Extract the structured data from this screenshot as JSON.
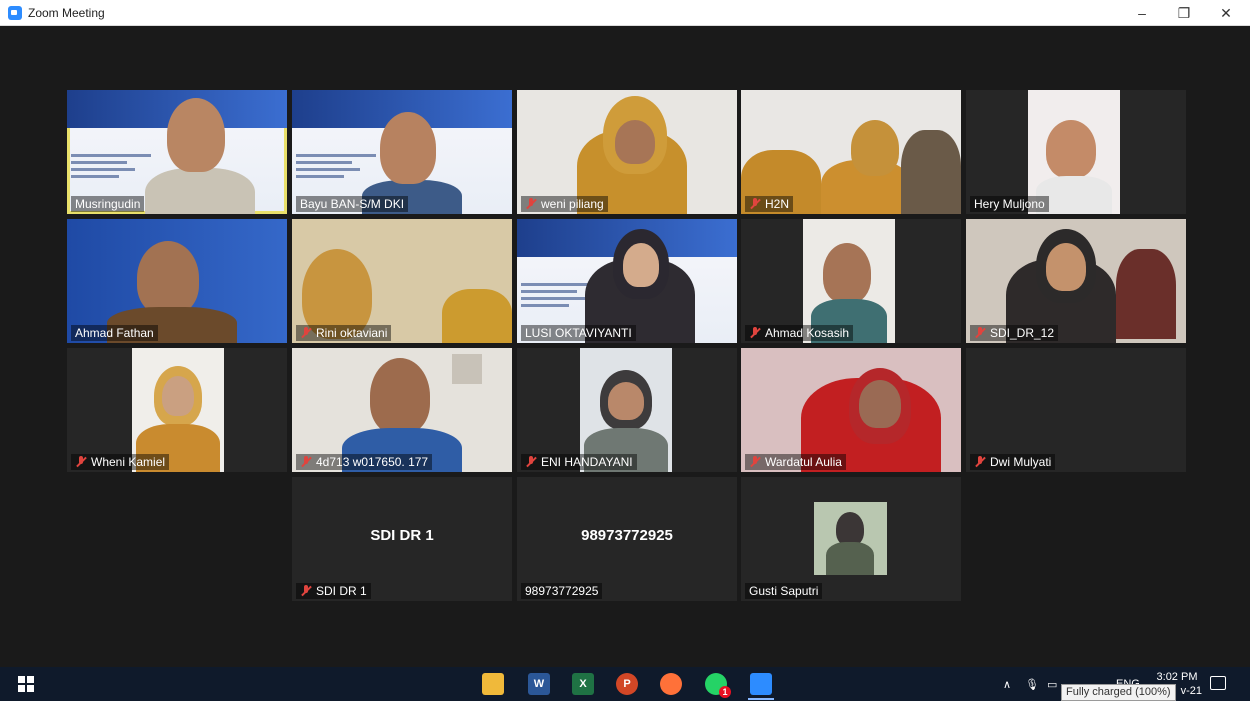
{
  "window": {
    "title": "Zoom Meeting"
  },
  "window_controls": {
    "minimize": "–",
    "restore": "❐",
    "close": "✕"
  },
  "participants": [
    {
      "name": "Musringudin",
      "muted": false,
      "active_speaker": true,
      "kind": "slide"
    },
    {
      "name": "Bayu BAN-S/M DKI",
      "muted": false,
      "active_speaker": false,
      "kind": "slide"
    },
    {
      "name": "weni piliang",
      "muted": true,
      "active_speaker": false,
      "kind": "video"
    },
    {
      "name": "H2N",
      "muted": true,
      "active_speaker": false,
      "kind": "video"
    },
    {
      "name": "Hery Muljono",
      "muted": false,
      "active_speaker": false,
      "kind": "video-small"
    },
    {
      "name": "Ahmad Fathan",
      "muted": false,
      "active_speaker": false,
      "kind": "slide"
    },
    {
      "name": "Rini oktaviani",
      "muted": true,
      "active_speaker": false,
      "kind": "video"
    },
    {
      "name": "LUSI OKTAVIYANTI",
      "muted": false,
      "active_speaker": false,
      "kind": "slide"
    },
    {
      "name": "Ahmad Kosasih",
      "muted": true,
      "active_speaker": false,
      "kind": "video-small"
    },
    {
      "name": "SDI_DR_12",
      "muted": true,
      "active_speaker": false,
      "kind": "video"
    },
    {
      "name": "Wheni Kamiel",
      "muted": true,
      "active_speaker": false,
      "kind": "video-small"
    },
    {
      "name": "4d713 w017650. 177",
      "muted": true,
      "active_speaker": false,
      "kind": "video"
    },
    {
      "name": "ENI HANDAYANI",
      "muted": true,
      "active_speaker": false,
      "kind": "video-small"
    },
    {
      "name": "Wardatul Aulia",
      "muted": true,
      "active_speaker": false,
      "kind": "video"
    },
    {
      "name": "Dwi Mulyati",
      "muted": true,
      "active_speaker": false,
      "kind": "off"
    },
    {
      "name": "SDI DR 1",
      "muted": true,
      "active_speaker": false,
      "kind": "off",
      "display_text": "SDI DR 1"
    },
    {
      "name": "98973772925",
      "muted": false,
      "active_speaker": false,
      "kind": "off",
      "display_text": "98973772925"
    },
    {
      "name": "Gusti Saputri",
      "muted": false,
      "active_speaker": false,
      "kind": "photo"
    }
  ],
  "colors": {
    "active_speaker_border": "#e9e06a",
    "mute_icon": "#e0443e",
    "background": "#1a1a1a",
    "tile": "#262626"
  },
  "taskbar": {
    "apps": [
      "file-explorer-icon",
      "word-icon",
      "excel-icon",
      "powerpoint-icon",
      "firefox-icon",
      "whatsapp-icon",
      "zoom-icon"
    ],
    "whatsapp_badge": "1",
    "tray_language": "ENG",
    "clock_time": "3:02 PM",
    "clock_date": "v-21",
    "battery_tooltip": "Fully charged (100%)"
  }
}
